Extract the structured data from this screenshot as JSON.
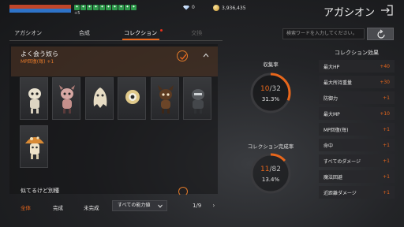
{
  "hud": {
    "buffs": [
      "✦",
      "✦",
      "✦",
      "✦",
      "✦",
      "✦",
      "✦",
      "✦",
      "✦",
      "✦"
    ],
    "buff_count": "+5",
    "gems": "0",
    "gold": "3,936,435"
  },
  "header": {
    "title": "アガシオン"
  },
  "tabs": [
    {
      "label": "アガシオン"
    },
    {
      "label": "合成"
    },
    {
      "label": "コレクション"
    },
    {
      "label": "交換"
    }
  ],
  "search": {
    "placeholder": "検索ワードを入力してください。"
  },
  "collection": {
    "group1_title": "よく会う奴ら",
    "group1_bonus": "MP回復(毎)  +1",
    "group2_title": "似てるけど別種"
  },
  "filters": {
    "all": "全体",
    "complete": "完成",
    "incomplete": "未完成",
    "ability_select": "すべての能力値",
    "page": "1/9"
  },
  "stats": {
    "collection_rate_label": "収集率",
    "collected": "10",
    "collected_total": "/32",
    "collection_rate": 0.313,
    "collection_rate_pct": "31.3%",
    "completion_label": "コレクション完成率",
    "completed": "11",
    "completed_total": "/82",
    "completion_rate": 0.134,
    "completion_rate_pct": "13.4%"
  },
  "effects": {
    "title": "コレクション効果",
    "items": [
      {
        "name": "最大HP",
        "value": "+40"
      },
      {
        "name": "最大所持重量",
        "value": "+30"
      },
      {
        "name": "防御力",
        "value": "+1"
      },
      {
        "name": "最大MP",
        "value": "+10"
      },
      {
        "name": "MP回復(毎)",
        "value": "+1"
      },
      {
        "name": "命中",
        "value": "+1"
      },
      {
        "name": "すべてのダメージ",
        "value": "+1"
      },
      {
        "name": "魔法回避",
        "value": "+1"
      },
      {
        "name": "近距離ダメージ",
        "value": "+1"
      }
    ]
  },
  "colors": {
    "accent": "#e8661b",
    "hp": "#c0462a",
    "mp": "#2e73c8"
  }
}
